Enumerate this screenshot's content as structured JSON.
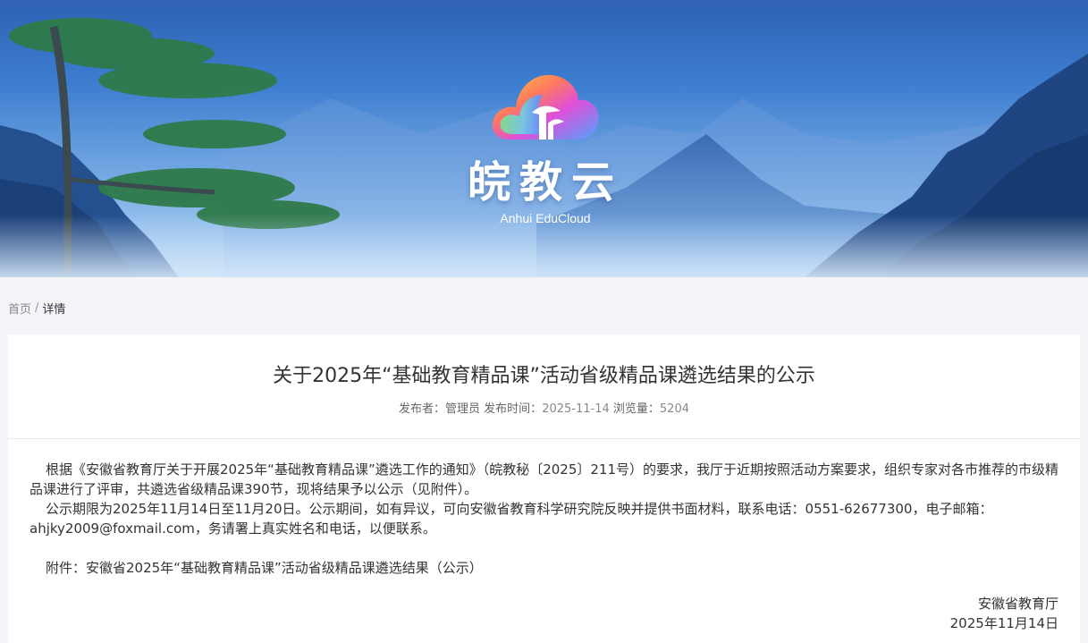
{
  "banner": {
    "logo_title": "皖教云",
    "logo_subtitle": "Anhui EduCloud"
  },
  "breadcrumb": {
    "home": "首页",
    "separator": "/",
    "current": "详情"
  },
  "article": {
    "title": "关于2025年“基础教育精品课”活动省级精品课遴选结果的公示",
    "meta": {
      "publisher_label": "发布者：",
      "publisher": "管理员",
      "time_label": "发布时间：",
      "time": "2025-11-14",
      "views_label": "浏览量：",
      "views": "5204"
    },
    "paragraphs": [
      "根据《安徽省教育厅关于开展2025年“基础教育精品课”遴选工作的通知》（皖教秘〔2025〕211号）的要求，我厅于近期按照活动方案要求，组织专家对各市推荐的市级精品课进行了评审，共遴选省级精品课390节，现将结果予以公示（见附件）。",
      "公示期限为2025年11月14日至11月20日。公示期间，如有异议，可向安徽省教育科学研究院反映并提供书面材料，联系电话：0551-62677300，电子邮箱：ahjky2009@foxmail.com，务请署上真实姓名和电话，以便联系。"
    ],
    "attachment": "附件：安徽省2025年“基础教育精品课”活动省级精品课遴选结果（公示）",
    "signature": {
      "org": "安徽省教育厅",
      "date": "2025年11月14日"
    }
  }
}
